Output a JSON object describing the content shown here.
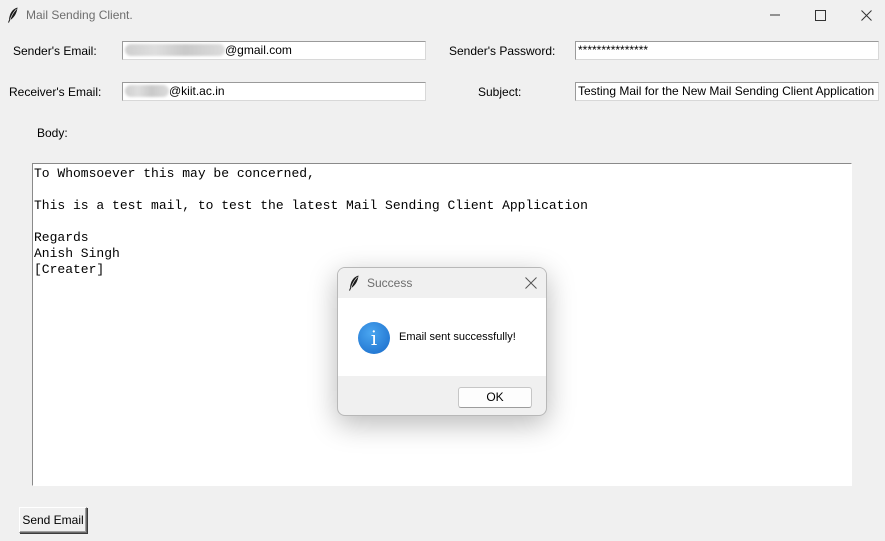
{
  "window": {
    "title": "Mail Sending Client.",
    "icon": "feather-icon"
  },
  "form": {
    "sender_email_label": "Sender's Email:",
    "sender_email_suffix": "@gmail.com",
    "sender_password_label": "Sender's Password:",
    "sender_password_value": "***************",
    "receiver_email_label": "Receiver's Email:",
    "receiver_email_suffix": "@kiit.ac.in",
    "subject_label": "Subject:",
    "subject_value": "Testing Mail for the New Mail Sending Client Application",
    "body_label": "Body:",
    "body_value": "To Whomsoever this may be concerned,\n\nThis is a test mail, to test the latest Mail Sending Client Application\n\nRegards\nAnish Singh\n[Creater]",
    "send_button": "Send Email"
  },
  "dialog": {
    "title": "Success",
    "icon": "info-icon",
    "icon_glyph": "i",
    "message": "Email sent successfully!",
    "ok_button": "OK"
  },
  "colors": {
    "background": "#f0f0f0",
    "info_blue": "#1769c9"
  }
}
